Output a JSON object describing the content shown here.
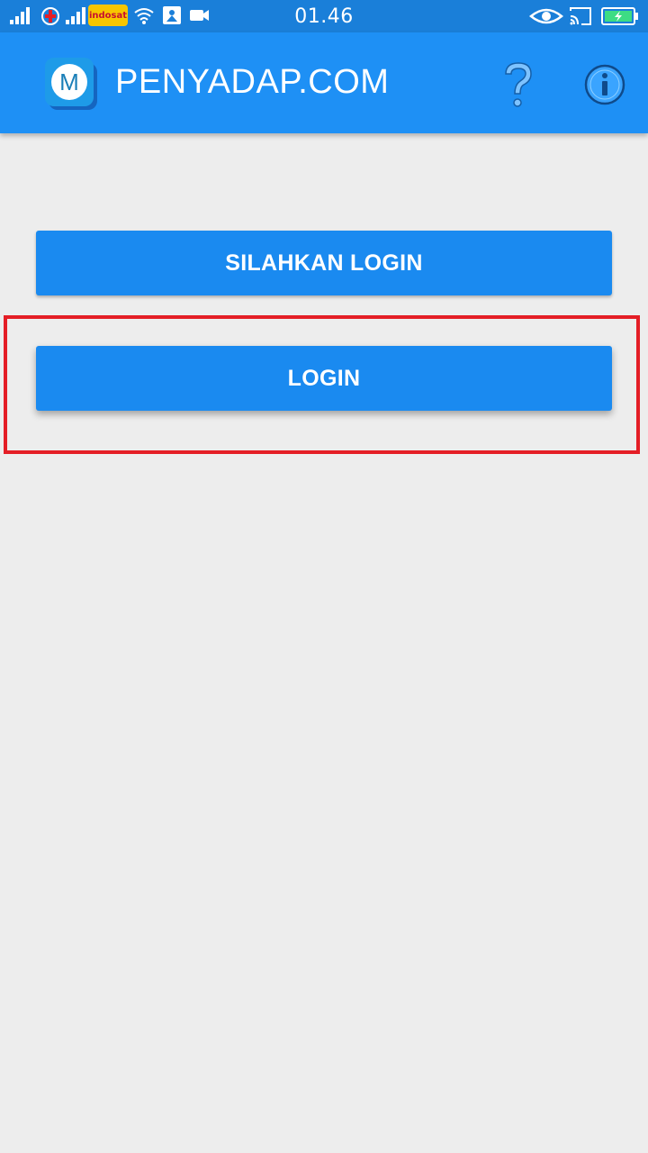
{
  "status_bar": {
    "time": "01.46",
    "carrier_badge": "indosat"
  },
  "app_bar": {
    "logo_letter": "M",
    "title": "PENYADAP.COM"
  },
  "buttons": {
    "silahkan_login": "SILAHKAN LOGIN",
    "login": "LOGIN"
  },
  "colors": {
    "status_bar": "#1a7fd9",
    "app_bar": "#1e90f5",
    "button": "#1a8af0",
    "background": "#ededed",
    "highlight": "#e41e26"
  },
  "icons": [
    "signal-icon",
    "airplane-icon",
    "wifi-icon",
    "notification-icon",
    "video-icon",
    "eye-icon",
    "cast-icon",
    "battery-icon",
    "help-icon",
    "info-icon"
  ]
}
